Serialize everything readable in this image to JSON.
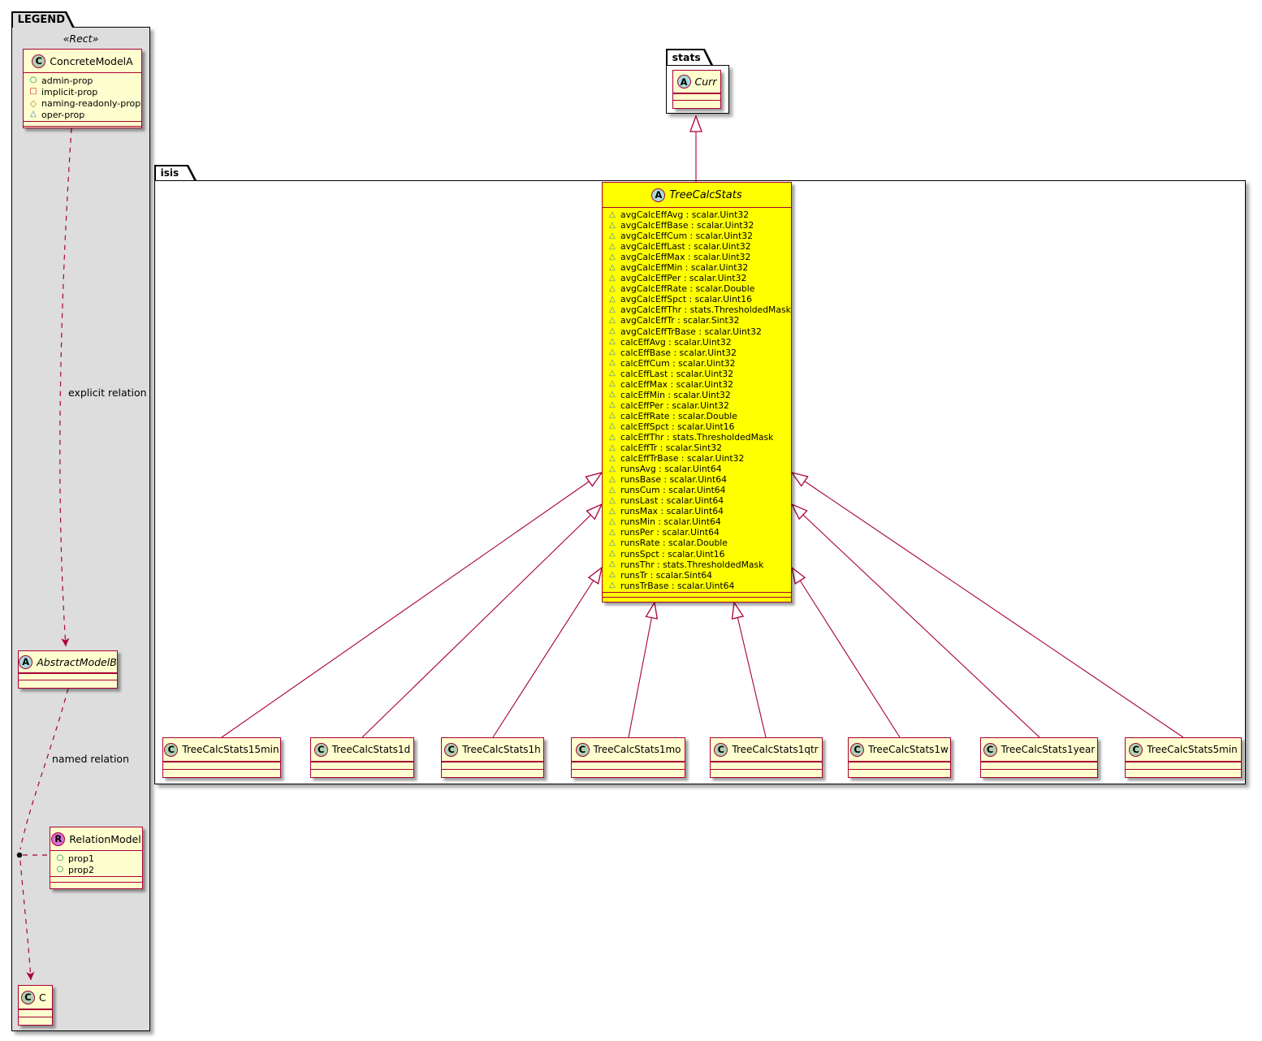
{
  "colors": {
    "line": "#A80036",
    "classFill": "#FEFECE",
    "highlight": "#FFFF00",
    "spotClass": "#ADD1B2",
    "spotAbstract": "#A9DCDF",
    "spotRelation": "#DA70D6",
    "legendBg": "#DDDDDD",
    "iconPublic": "#038048",
    "iconPrivate": "#C82930",
    "iconProtected": "#B38D22",
    "iconPackage": "#3C7EBF"
  },
  "spots": {
    "class": "C",
    "abstract": "A",
    "relation": "R"
  },
  "legend": {
    "tab_label": "LEGEND",
    "stereotype": "«Rect»",
    "concrete_model": {
      "name": "ConcreteModelA",
      "props": [
        "admin-prop",
        "implicit-prop",
        "naming-readonly-prop",
        "oper-prop"
      ]
    },
    "explicit_relation_label": "explicit relation",
    "abstract_model": {
      "name": "AbstractModelB"
    },
    "named_relation_label": "named relation",
    "relation_model": {
      "name": "RelationModel",
      "props": [
        "prop1",
        "prop2"
      ]
    },
    "terminal_class": {
      "name": "C"
    }
  },
  "stats_package": {
    "tab_label": "stats",
    "curr_class": {
      "name": "Curr"
    }
  },
  "isis_package": {
    "tab_label": "isis",
    "tree_calc_stats": {
      "name": "TreeCalcStats",
      "attributes": [
        "avgCalcEffAvg : scalar.Uint32",
        "avgCalcEffBase : scalar.Uint32",
        "avgCalcEffCum : scalar.Uint32",
        "avgCalcEffLast : scalar.Uint32",
        "avgCalcEffMax : scalar.Uint32",
        "avgCalcEffMin : scalar.Uint32",
        "avgCalcEffPer : scalar.Uint32",
        "avgCalcEffRate : scalar.Double",
        "avgCalcEffSpct : scalar.Uint16",
        "avgCalcEffThr : stats.ThresholdedMask",
        "avgCalcEffTr : scalar.Sint32",
        "avgCalcEffTrBase : scalar.Uint32",
        "calcEffAvg : scalar.Uint32",
        "calcEffBase : scalar.Uint32",
        "calcEffCum : scalar.Uint32",
        "calcEffLast : scalar.Uint32",
        "calcEffMax : scalar.Uint32",
        "calcEffMin : scalar.Uint32",
        "calcEffPer : scalar.Uint32",
        "calcEffRate : scalar.Double",
        "calcEffSpct : scalar.Uint16",
        "calcEffThr : stats.ThresholdedMask",
        "calcEffTr : scalar.Sint32",
        "calcEffTrBase : scalar.Uint32",
        "runsAvg : scalar.Uint64",
        "runsBase : scalar.Uint64",
        "runsCum : scalar.Uint64",
        "runsLast : scalar.Uint64",
        "runsMax : scalar.Uint64",
        "runsMin : scalar.Uint64",
        "runsPer : scalar.Uint64",
        "runsRate : scalar.Double",
        "runsSpct : scalar.Uint16",
        "runsThr : stats.ThresholdedMask",
        "runsTr : scalar.Sint64",
        "runsTrBase : scalar.Uint64"
      ]
    },
    "subclasses": [
      "TreeCalcStats15min",
      "TreeCalcStats1d",
      "TreeCalcStats1h",
      "TreeCalcStats1mo",
      "TreeCalcStats1qtr",
      "TreeCalcStats1w",
      "TreeCalcStats1year",
      "TreeCalcStats5min"
    ]
  }
}
